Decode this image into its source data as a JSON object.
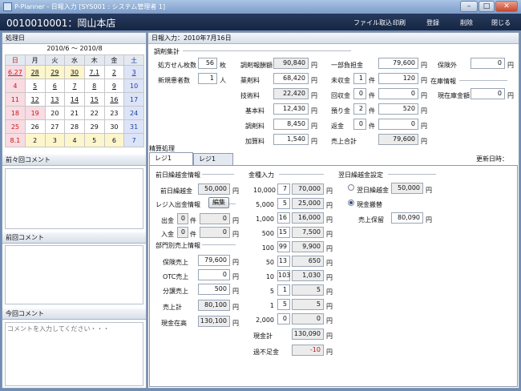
{
  "window": {
    "title": "P-Planner - 日報入力 [SYS001 : システム管理者 1]"
  },
  "header": {
    "store": "0010010001：岡山本店",
    "menu": [
      "ファイル取込",
      "印刷",
      "登録",
      "削除",
      "閉じる"
    ]
  },
  "left": {
    "section_title": "処理日",
    "cal_title": "2010/6 ～ 2010/8",
    "weekdays": [
      "日",
      "月",
      "火",
      "水",
      "木",
      "金",
      "土"
    ],
    "weeks": [
      [
        "6.27",
        "28",
        "29",
        "30",
        "7.1",
        "2",
        "3"
      ],
      [
        "4",
        "5",
        "6",
        "7",
        "8",
        "9",
        "10"
      ],
      [
        "11",
        "12",
        "13",
        "14",
        "15",
        "16",
        "17"
      ],
      [
        "18",
        "19",
        "20",
        "21",
        "22",
        "23",
        "24"
      ],
      [
        "25",
        "26",
        "27",
        "28",
        "29",
        "30",
        "31"
      ],
      [
        "8.1",
        "2",
        "3",
        "4",
        "5",
        "6",
        "7"
      ]
    ],
    "prev2_comment": "前々回コメント",
    "prev_comment": "前回コメント",
    "this_comment": "今回コメント",
    "comment_placeholder": "コメントを入力してください・・・"
  },
  "right": {
    "title": "日報入力：2010年7月16日",
    "chosei": "調剤集計",
    "rx_count_label": "処方せん枚数",
    "rx_count": "56",
    "rx_unit": "枚",
    "new_label": "新規患者数",
    "new_count": "1",
    "new_unit": "人",
    "rows": [
      {
        "label": "調剤報酬額",
        "value": "90,840"
      },
      {
        "label": "薬剤料",
        "value": "68,420"
      },
      {
        "label": "技術料",
        "value": "22,420"
      },
      {
        "label": "基本料",
        "value": "12,430"
      },
      {
        "label": "調剤料",
        "value": "8,450"
      },
      {
        "label": "加算料",
        "value": "1,540"
      }
    ],
    "col3": [
      {
        "label": "一部負担金",
        "cnt": "",
        "value": "79,600"
      },
      {
        "label": "未収金",
        "cnt": "1",
        "value": "120"
      },
      {
        "label": "回収金",
        "cnt": "0",
        "value": "0"
      },
      {
        "label": "預り金",
        "cnt": "2",
        "value": "520"
      },
      {
        "label": "返金",
        "cnt": "0",
        "value": "0"
      },
      {
        "label": "売上合計",
        "cnt": "",
        "value": "79,600"
      }
    ],
    "ken": "件",
    "yen": "円",
    "hoken_gai_label": "保険外",
    "hoken_gai": "0",
    "zaiko": "在庫情報",
    "zaiko_label": "現在庫金額",
    "zaiko_value": "0",
    "seisan": "精算処理",
    "tabs": [
      "レジ1",
      "レジ1"
    ],
    "updated": "更新日時：",
    "prev_balance_group": "前日繰越金情報",
    "prev_balance_label": "前日繰越金",
    "prev_balance": "50,000",
    "cash_group": "レジ入出金情報",
    "edit_btn": "編集",
    "out_label": "出金",
    "out_cnt": "0",
    "out_val": "0",
    "in_label": "入金",
    "in_cnt": "0",
    "in_val": "0",
    "dept_group": "部門別売上情報",
    "dept": [
      {
        "label": "保険売上",
        "value": "79,600"
      },
      {
        "label": "OTC売上",
        "value": "0"
      },
      {
        "label": "分譲売上",
        "value": "500"
      },
      {
        "label": "売上計",
        "value": "80,100"
      },
      {
        "label": "現金在高",
        "value": "130,100"
      }
    ],
    "money_group": "金種入力",
    "money": [
      {
        "label": "10,000",
        "cnt": "7",
        "value": "70,000"
      },
      {
        "label": "5,000",
        "cnt": "5",
        "value": "25,000"
      },
      {
        "label": "1,000",
        "cnt": "16",
        "value": "16,000"
      },
      {
        "label": "500",
        "cnt": "15",
        "value": "7,500"
      },
      {
        "label": "100",
        "cnt": "99",
        "value": "9,900"
      },
      {
        "label": "50",
        "cnt": "13",
        "value": "650"
      },
      {
        "label": "10",
        "cnt": "103",
        "value": "1,030"
      },
      {
        "label": "5",
        "cnt": "1",
        "value": "5"
      },
      {
        "label": "1",
        "cnt": "5",
        "value": "5"
      },
      {
        "label": "2,000",
        "cnt": "0",
        "value": "0"
      }
    ],
    "money_total_label": "現金計",
    "money_total": "130,090",
    "diff_label": "過不足金",
    "diff": "-10",
    "next_group": "翌日繰越金設定",
    "next_radio1": "翌日繰越金",
    "next_value": "50,000",
    "next_radio2": "現金搬替",
    "next_sales_label": "売上保留",
    "next_sales": "80,090"
  },
  "colors": {
    "accent": "#1d3fa0",
    "holiday": "#c21a1a"
  }
}
